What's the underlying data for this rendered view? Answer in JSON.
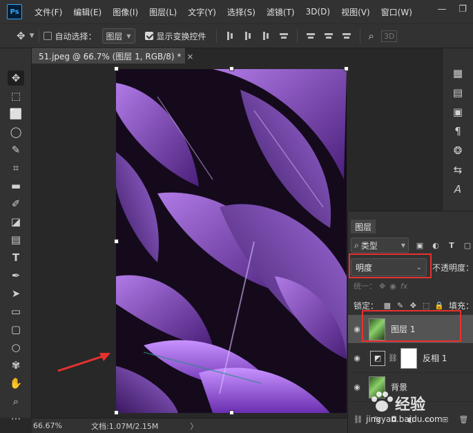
{
  "app": {
    "logo_text": "Ps"
  },
  "menu": [
    "文件(F)",
    "编辑(E)",
    "图像(I)",
    "图层(L)",
    "文字(Y)",
    "选择(S)",
    "滤镜(T)",
    "3D(D)",
    "视图(V)",
    "窗口(W)"
  ],
  "window_controls": {
    "minimize": "—",
    "restore": "❐"
  },
  "options": {
    "auto_select_label": "自动选择：",
    "auto_select_checked": false,
    "auto_select_target": "图层",
    "show_transform_label": "显示变换控件",
    "show_transform_checked": true,
    "mode_3d_label": "3D"
  },
  "document": {
    "tab_title": "51.jpeg @ 66.7% (图层 1, RGB/8) *",
    "close_glyph": "×"
  },
  "layers_panel": {
    "tab_label": "图层",
    "filter_label": "类型",
    "blend_mode": "明度",
    "opacity_label": "不透明度：",
    "unify_label": "统一：",
    "lock_label": "锁定：",
    "fill_label": "填充：",
    "layers": [
      {
        "name": "图层 1",
        "selected": true,
        "kind": "pixel"
      },
      {
        "name": "反相 1",
        "selected": false,
        "kind": "adjustment"
      },
      {
        "name": "背景",
        "selected": false,
        "kind": "background"
      }
    ]
  },
  "status": {
    "zoom": "66.67%",
    "doc_size": "文档:1.07M/2.15M",
    "arrow": "〉"
  },
  "watermark": {
    "text": "经验",
    "url": "jingyan.baidu.com"
  },
  "colors": {
    "annotation_red": "#e8312f",
    "accent_blue": "#31a8ff"
  }
}
